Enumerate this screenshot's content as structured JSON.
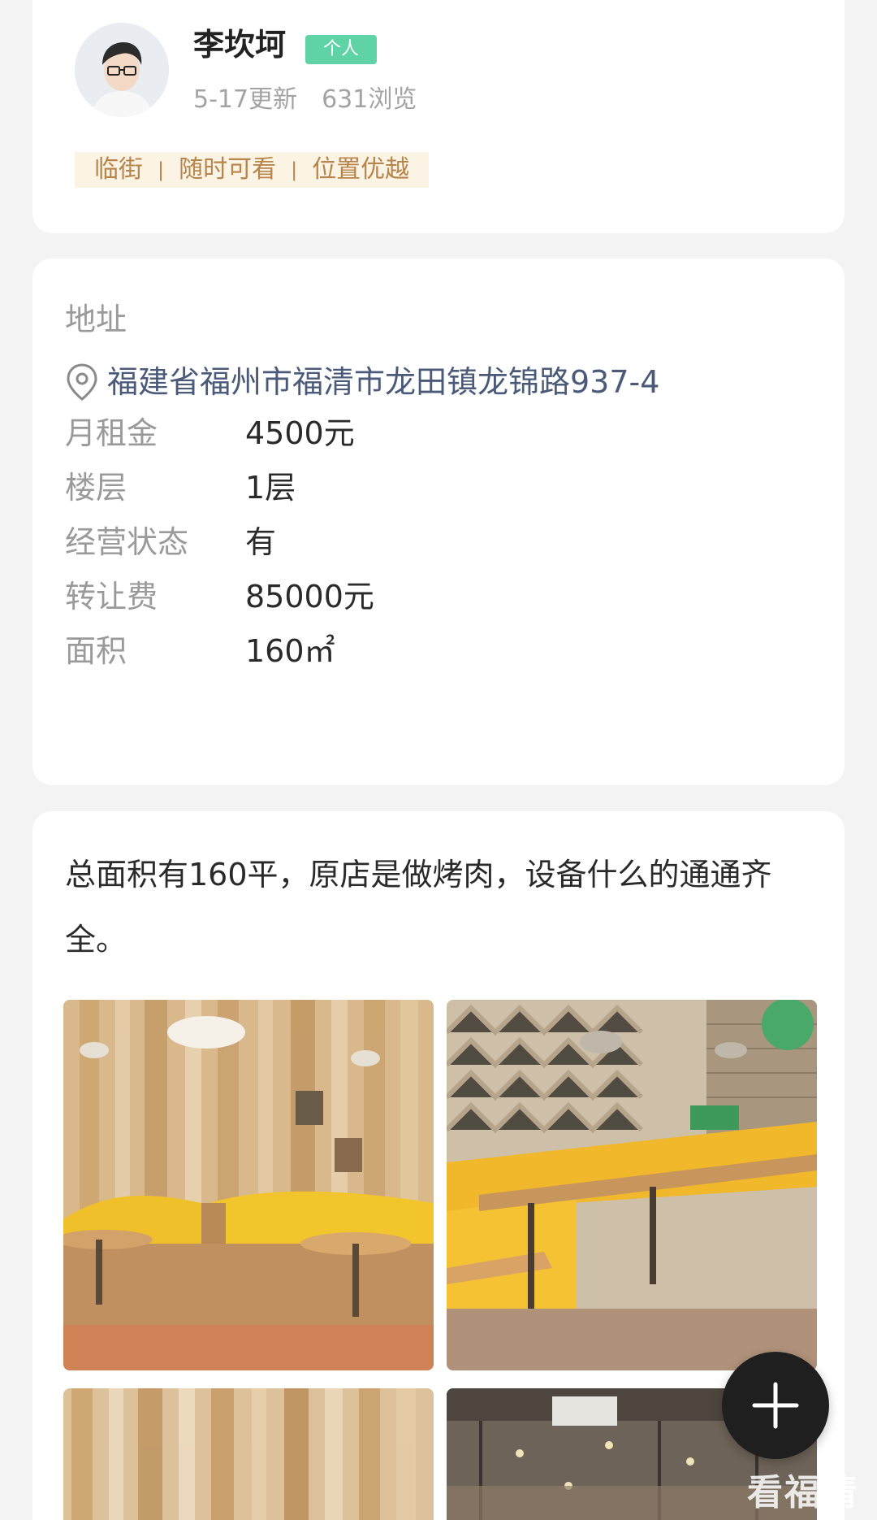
{
  "profile": {
    "name": "李坎坷",
    "badge": "个人",
    "updated": "5-17更新",
    "views": "631浏览",
    "tags": [
      "临街",
      "随时可看",
      "位置优越"
    ]
  },
  "details": {
    "address_label": "地址",
    "address": "福建省福州市福清市龙田镇龙锦路937-4",
    "rows": [
      {
        "label": "月租金",
        "value": "4500元"
      },
      {
        "label": "楼层",
        "value": "1层"
      },
      {
        "label": "经营状态",
        "value": "有"
      },
      {
        "label": "转让费",
        "value": "85000元"
      },
      {
        "label": "面积",
        "value": "160㎡"
      }
    ]
  },
  "description": {
    "text": "总面积有160平，原店是做烤肉，设备什么的通通齐全。"
  },
  "watermark": "看福清",
  "colors": {
    "badge": "#5fd3a6",
    "tag_bg": "#fbf3e3",
    "tag_text": "#b7854b",
    "address_text": "#4a5a78",
    "fab": "#1f1f1f"
  },
  "icons": {
    "address": "location-pin-icon",
    "fab": "plus-icon"
  }
}
